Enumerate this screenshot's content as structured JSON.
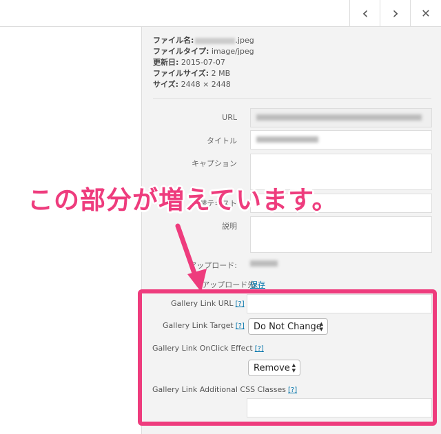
{
  "nav": {
    "prev_icon": "‹",
    "next_icon": "›",
    "close_icon": "✕"
  },
  "meta": {
    "filename_label": "ファイル名:",
    "filename_suffix": ".jpeg",
    "filetype_label": "ファイルタイプ:",
    "filetype_value": "image/jpeg",
    "updated_label": "更新日:",
    "updated_value": "2015-07-07",
    "filesize_label": "ファイルサイズ:",
    "filesize_value": "2 MB",
    "size_label": "サイズ:",
    "size_value": "2448 × 2448"
  },
  "fields": {
    "url_label": "URL",
    "title_label": "タイトル",
    "caption_label": "キャプション",
    "alt_label": "代替テキスト",
    "description_label": "説明",
    "uploader_label": "アップロード:",
    "uploaded_to_label": "アップロード先:",
    "save_link": "保存"
  },
  "overlay": {
    "callout": "この部分が増えています。",
    "accent_color": "#ee3c7d"
  },
  "gallery_link": {
    "url_label": "Gallery Link URL",
    "target_label": "Gallery Link Target",
    "target_value": "Do Not Change",
    "onclick_label": "Gallery Link OnClick Effect",
    "onclick_value": "Remove",
    "css_label": "Gallery Link Additional CSS Classes",
    "help": "[?]"
  }
}
